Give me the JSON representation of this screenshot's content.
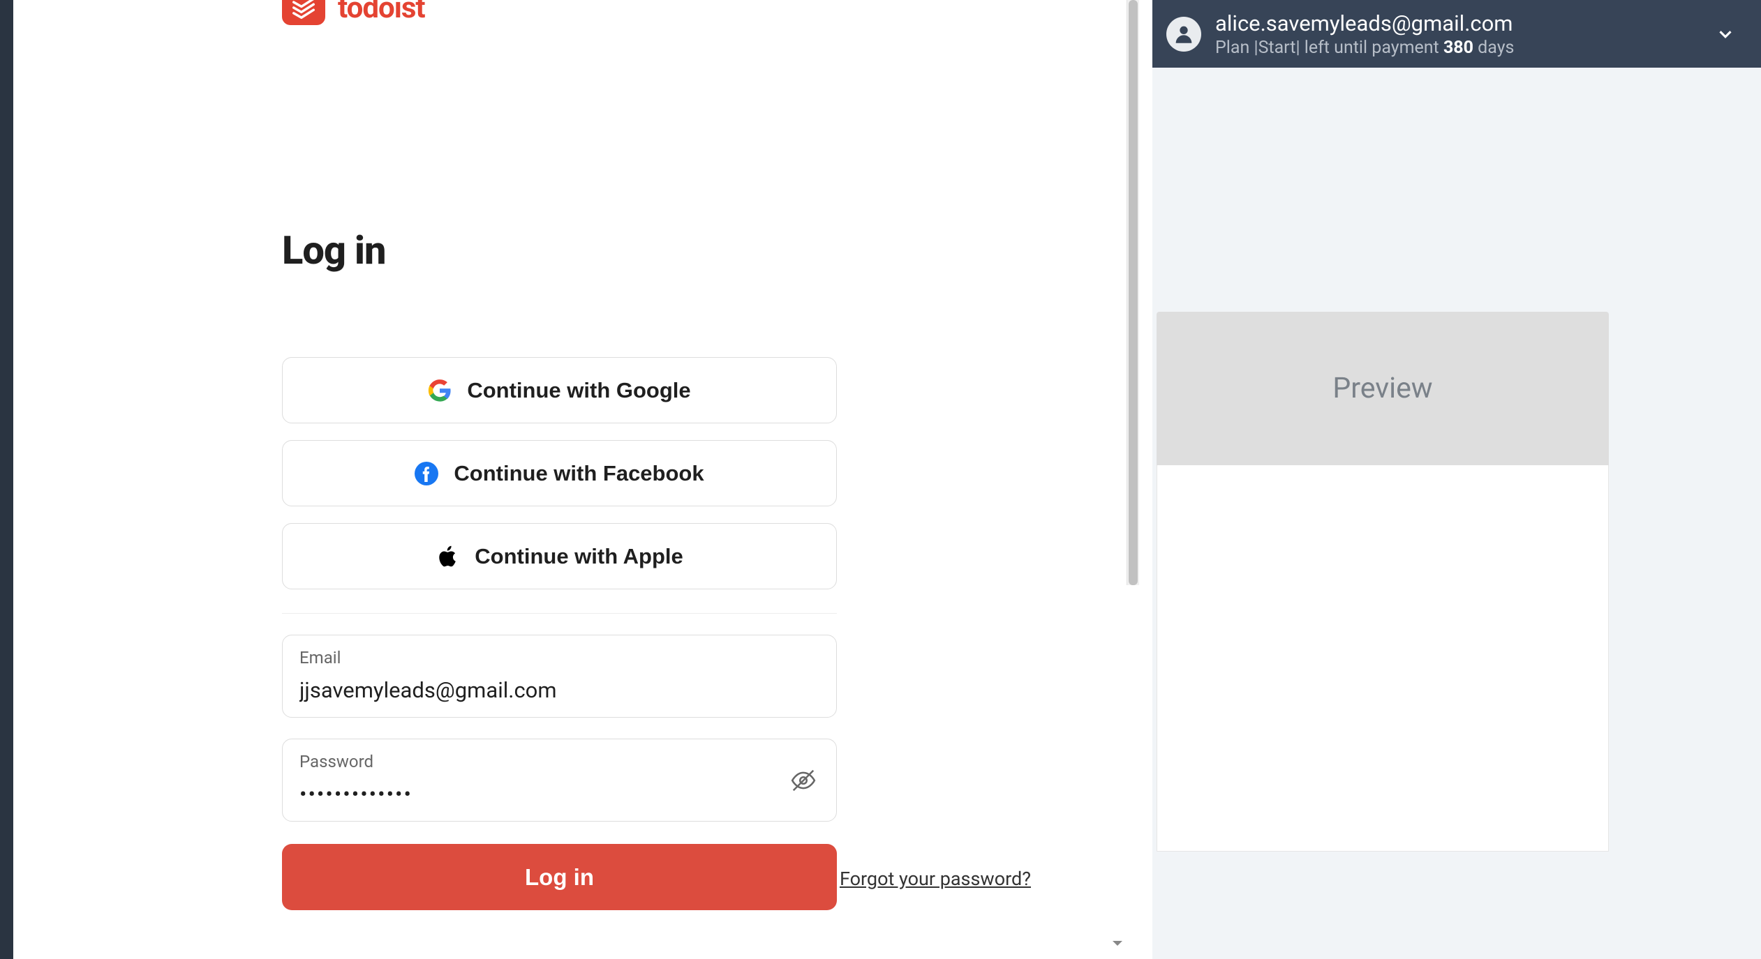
{
  "login": {
    "brand": "todoist",
    "heading": "Log in",
    "oauth": {
      "google": "Continue with Google",
      "facebook": "Continue with Facebook",
      "apple": "Continue with Apple"
    },
    "email_label": "Email",
    "email_value": "jjsavemyleads@gmail.com",
    "password_label": "Password",
    "password_value": "•••••••••••••",
    "login_button": "Log in",
    "forgot_link": "Forgot your password?"
  },
  "account": {
    "email": "alice.savemyleads@gmail.com",
    "plan_prefix": "Plan |",
    "plan_name": "Start",
    "plan_mid": "|  left until payment ",
    "days_num": "380",
    "days_suffix": " days"
  },
  "preview": {
    "title": "Preview"
  }
}
